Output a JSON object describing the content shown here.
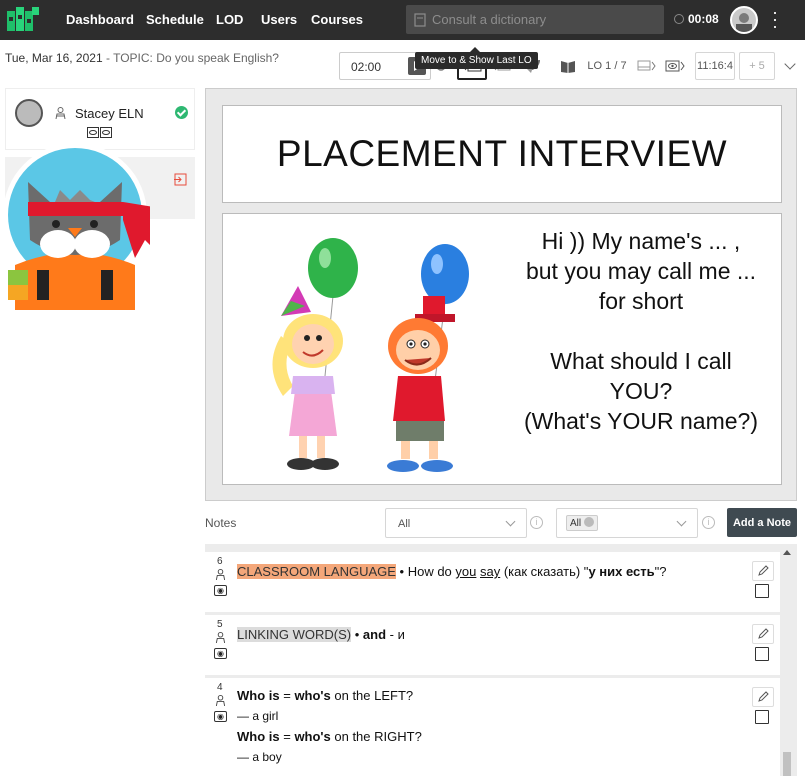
{
  "navbar": {
    "links": [
      "Dashboard",
      "Schedule",
      "LOD",
      "Users",
      "Courses"
    ],
    "dictionary_placeholder": "Consult a dictionary",
    "timer": "00:08",
    "menu_icon": "kebab-icon"
  },
  "session": {
    "date": "Tue, Mar 16, 2021",
    "topic_prefix": "TOPIC:",
    "topic": "Do you speak English?",
    "time_input": "02:00",
    "lo_counter": "LO 1 / 7",
    "clock_time": "11:16:4",
    "plus": "+ 5",
    "tooltip": "Move to & Show Last LO"
  },
  "participants": {
    "student_name": "Stacey ELN",
    "student_status_color": "#2eb872",
    "teacher_exit_color": "#e74c3c"
  },
  "slide": {
    "title": "PLACEMENT INTERVIEW",
    "lines": [
      "Hi )) My name's ... ,",
      "but you may call me ...",
      "for short",
      "",
      "What should I call",
      "YOU?",
      "(What's YOUR name?)"
    ]
  },
  "notes": {
    "label": "Notes",
    "filter1": "All",
    "filter2_chip": "All",
    "add_label": "Add a Note",
    "items": [
      {
        "num": "6",
        "tag": "CLASSROOM LANGUAGE",
        "sep": " • How do ",
        "you": "you",
        "say": "say",
        "rest": " (как сказать) \"",
        "bold": "у них есть",
        "end": "\"?"
      },
      {
        "num": "5",
        "tag": "LINKING WORD(S)",
        "sep": " • ",
        "bold": "and",
        "rest": " - и"
      },
      {
        "num": "4",
        "line1_bold": "Who is",
        "line1_mid": " = ",
        "line1_bold2": "who's",
        "line1_rest": "  on the LEFT?",
        "line2": "— a girl",
        "line3_bold": "Who is",
        "line3_mid": " = ",
        "line3_bold2": "who's",
        "line3_rest": "  on the RIGHT?",
        "line4": "— a boy"
      }
    ]
  }
}
